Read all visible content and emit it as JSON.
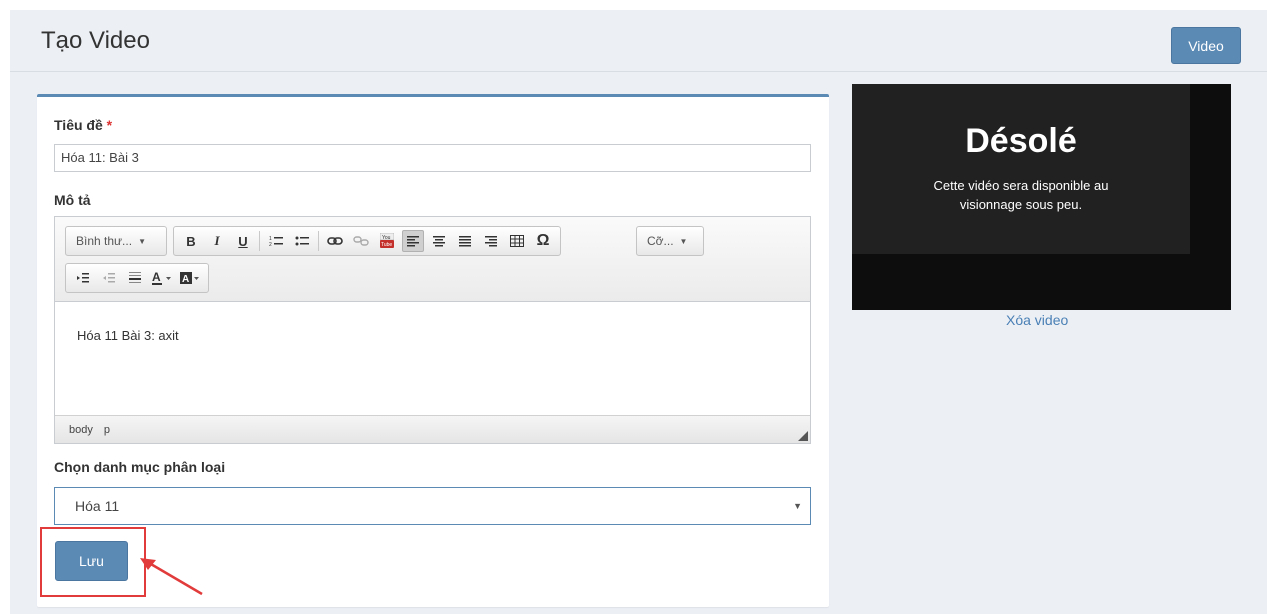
{
  "header": {
    "title": "Tạo Video",
    "video_button": "Video"
  },
  "form": {
    "title_label": "Tiêu đề",
    "required_mark": "*",
    "title_value": "Hóa 11: Bài 3",
    "description_label": "Mô tả",
    "editor": {
      "format_combo": "Bình thư...",
      "size_combo": "Cỡ...",
      "toolbar_buttons": [
        "B",
        "I",
        "U"
      ],
      "content": "Hóa 11 Bài 3: axit",
      "status_path": [
        "body",
        "p"
      ]
    },
    "category_label": "Chọn danh mục phân loại",
    "category_value": "Hóa 11",
    "save_button": "Lưu"
  },
  "video_preview": {
    "title": "Désolé",
    "message_line1": "Cette vidéo sera disponible au",
    "message_line2": "visionnage sous peu.",
    "delete_link": "Xóa video"
  },
  "colors": {
    "accent": "#5b8ab5",
    "highlight": "#e23b3b",
    "link": "#4a7fb5"
  }
}
